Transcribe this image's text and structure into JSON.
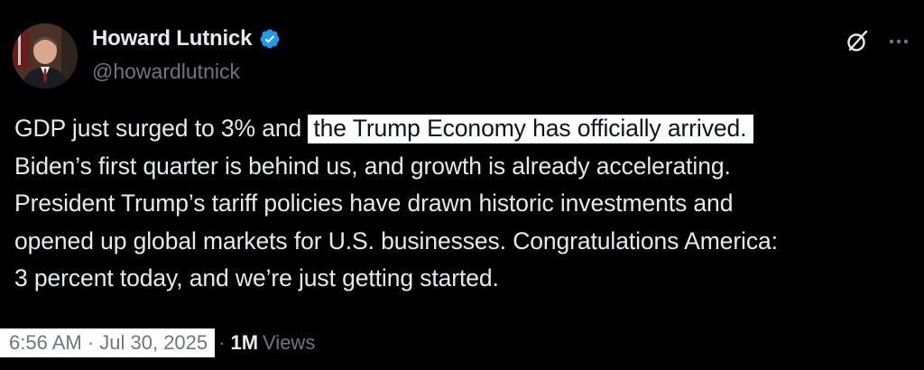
{
  "author": {
    "display_name": "Howard Lutnick",
    "handle": "@howardlutnick",
    "verified_icon": "verified-badge-icon"
  },
  "actions": {
    "grok_icon": "grok-icon",
    "more_icon": "more-icon"
  },
  "tweet": {
    "lines": [
      {
        "before": "GDP just surged to 3% and ",
        "highlight": "the Trump Economy has officially arrived."
      },
      {
        "text": "Biden’s first quarter is behind us, and growth is already accelerating."
      },
      {
        "text": "President Trump’s tariff policies have drawn historic investments and"
      },
      {
        "text": "opened up global markets for U.S. businesses. Congratulations America:"
      },
      {
        "text": "3 percent today, and we’re just getting started."
      }
    ]
  },
  "meta": {
    "timestamp": "6:56 AM · Jul 30, 2025",
    "separator": "·",
    "views_count": "1M",
    "views_label": "Views"
  },
  "colors": {
    "background": "#000000",
    "text_primary": "#e7e9ea",
    "text_secondary": "#71767b",
    "highlight_bg": "#ffffff",
    "verified_blue": "#1d9bf0"
  }
}
